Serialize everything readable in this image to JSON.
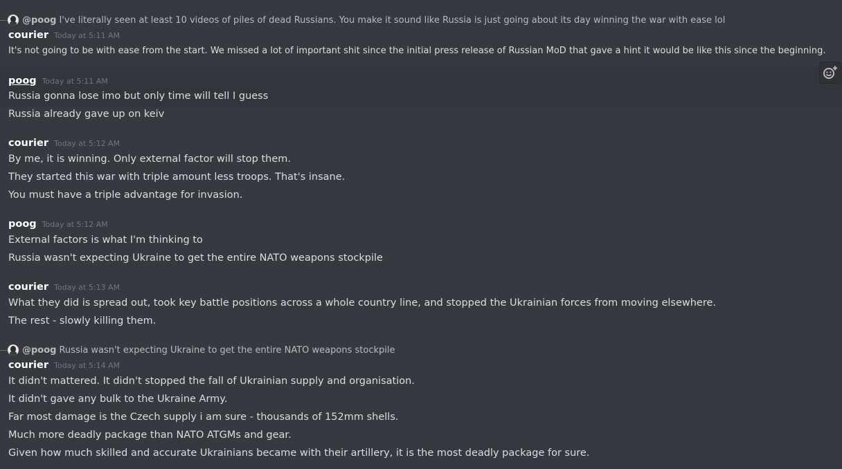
{
  "messages": [
    {
      "reply": {
        "author": "@poog",
        "text": "I've literally seen at least 10 videos of piles of dead Russians. You make it sound like Russia is just going about its day winning the war with ease lol"
      },
      "author": "courier",
      "timestamp": "Today at 5:11 AM",
      "lines": [
        "It's not going to be with ease from the start. We missed a lot of important shit since the initial press release of Russian MoD that gave a hint it would be like this since the beginning."
      ]
    },
    {
      "author": "poog",
      "timestamp": "Today at 5:11 AM",
      "lines": [
        "Russia gonna lose imo but only time will tell I guess",
        "Russia already gave up on keiv"
      ]
    },
    {
      "author": "courier",
      "timestamp": "Today at 5:12 AM",
      "lines": [
        "By me, it is winning. Only external factor will stop them.",
        "They started this war with triple amount less troops. That's insane.",
        "You must have a triple advantage for invasion."
      ]
    },
    {
      "author": "poog",
      "timestamp": "Today at 5:12 AM",
      "lines": [
        "External factors is what I'm thinking to",
        "Russia wasn't expecting Ukraine to get the entire NATO weapons stockpile"
      ]
    },
    {
      "author": "courier",
      "timestamp": "Today at 5:13 AM",
      "lines": [
        "What they did is spread out, took key battle positions across a whole country line, and stopped the Ukrainian forces from moving elsewhere.",
        "The rest - slowly killing them."
      ]
    },
    {
      "reply": {
        "author": "@poog",
        "text": "Russia wasn't expecting Ukraine to get the entire NATO weapons stockpile"
      },
      "author": "courier",
      "timestamp": "Today at 5:14 AM",
      "lines": [
        "It didn't mattered. It didn't stopped the fall of Ukrainian supply and organisation.",
        "It didn't gave any bulk to the Ukraine Army.",
        "Far most damage is the Czech supply i am sure - thousands of 152mm shells.",
        "Much more deadly package than NATO ATGMs and gear.",
        "Given how much skilled and accurate Ukrainians became with their artillery, it is the most deadly package for sure."
      ]
    }
  ],
  "toolbar": {
    "add_reaction_icon": "add-reaction-icon"
  },
  "colors": {
    "background": "#36393f",
    "hover_background": "#32353b",
    "author": "#ffffff",
    "timestamp": "#72767d",
    "message_text": "#dcddde",
    "reply_text": "#b9bbbe"
  }
}
